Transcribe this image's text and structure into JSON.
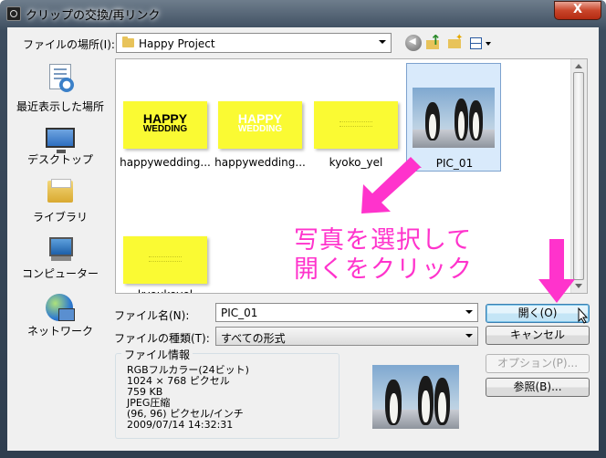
{
  "window": {
    "title": "クリップの交換/再リンク",
    "close_symbol": "X"
  },
  "lookin": {
    "label": "ファイルの場所(I):",
    "value": "Happy Project"
  },
  "toolbar": {
    "icons": [
      "back-icon",
      "up-folder-icon",
      "new-folder-icon",
      "views-menu-icon"
    ]
  },
  "places": [
    {
      "label": "最近表示した場所",
      "icon": "recent-places-icon"
    },
    {
      "label": "デスクトップ",
      "icon": "desktop-icon"
    },
    {
      "label": "ライブラリ",
      "icon": "libraries-icon"
    },
    {
      "label": "コンピューター",
      "icon": "computer-icon"
    },
    {
      "label": "ネットワーク",
      "icon": "network-icon"
    }
  ],
  "files": [
    {
      "label": "happywedding...",
      "thumb_text": [
        "HAPPY",
        "WEDDING"
      ],
      "thumb_color": "#111111"
    },
    {
      "label": "happywedding...",
      "thumb_text": [
        "HAPPY",
        "WEDDING"
      ],
      "thumb_color": "#ffffff"
    },
    {
      "label": "kyoko_yel"
    },
    {
      "label": "PIC_01",
      "selected": true
    },
    {
      "label": "kyoukoyel"
    }
  ],
  "annotation": {
    "line1": "写真を選択して",
    "line2": "開くをクリック",
    "color": "#ff33cc"
  },
  "filename": {
    "label": "ファイル名(N):",
    "value": "PIC_01"
  },
  "filetype": {
    "label": "ファイルの種類(T):",
    "value": "すべての形式"
  },
  "buttons": {
    "open": "開く(O)",
    "cancel": "キャンセル",
    "options": "オプション(P)...",
    "browse": "参照(B)..."
  },
  "file_info": {
    "title": "ファイル情報",
    "lines": [
      "RGBフルカラー(24ビット)",
      "1024 × 768 ピクセル",
      "759 KB",
      "JPEG圧縮",
      "(96, 96) ピクセル/インチ",
      "2009/07/14  14:32:31"
    ]
  }
}
